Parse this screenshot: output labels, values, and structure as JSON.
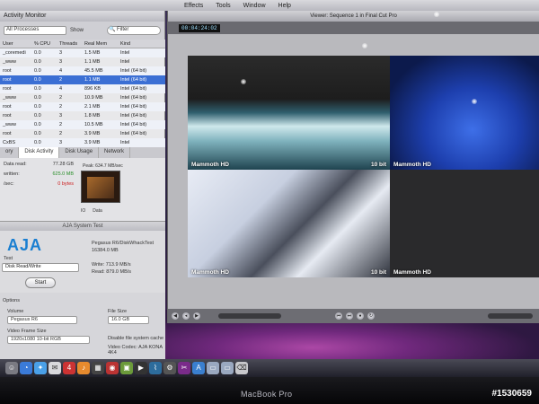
{
  "menubar": {
    "items": [
      "Effects",
      "Tools",
      "Window",
      "Help"
    ]
  },
  "activity_monitor": {
    "title": "Activity Monitor",
    "process_filter": "All Processes",
    "search_placeholder": "Filter",
    "col_show": "Show",
    "col_filter": "Filter",
    "columns": [
      "User",
      "% CPU",
      "Threads",
      "Real Mem",
      "Kind"
    ],
    "rows": [
      [
        "_coremedi",
        "0.0",
        "3",
        "1.5 MB",
        "Intel"
      ],
      [
        "_www",
        "0.0",
        "3",
        "1.1 MB",
        "Intel"
      ],
      [
        "root",
        "0.0",
        "4",
        "45.5 MB",
        "Intel (64 bit)"
      ],
      [
        "root",
        "0.0",
        "2",
        "1.1 MB",
        "Intel (64 bit)"
      ],
      [
        "root",
        "0.0",
        "4",
        "896 KB",
        "Intel (64 bit)"
      ],
      [
        "_www",
        "0.0",
        "2",
        "10.9 MB",
        "Intel (64 bit)"
      ],
      [
        "root",
        "0.0",
        "2",
        "2.1 MB",
        "Intel (64 bit)"
      ],
      [
        "root",
        "0.0",
        "3",
        "1.8 MB",
        "Intel (64 bit)"
      ],
      [
        "_www",
        "0.0",
        "2",
        "10.5 MB",
        "Intel (64 bit)"
      ],
      [
        "root",
        "0.0",
        "2",
        "3.9 MB",
        "Intel (64 bit)"
      ],
      [
        "CxBS",
        "0.0",
        "3",
        "3.9 MB",
        "Intel"
      ]
    ],
    "tabs": [
      "ory",
      "Disk Activity",
      "Disk Usage",
      "Network"
    ],
    "disk": {
      "peak": "Peak: 634.7 MB/sec",
      "data_read_label": "Data read:",
      "data_read_value": "77.28 GB",
      "written_label": "written:",
      "written_value": "625.0 MB",
      "sec_label": "/sec:",
      "sec_value": "0 bytes",
      "legend_io": "IO",
      "legend_data": "Data"
    }
  },
  "aja": {
    "title": "AJA System Test",
    "logo": "AJA",
    "volume_info": "Pegasus R6/DiskWhackTest",
    "volume_size": "16384.0 MB",
    "test_label": "Test",
    "mode": "Disk Read/Write",
    "start_label": "Start",
    "write": "Write: 713.9 MB/s",
    "read": "Read: 879.0 MB/s"
  },
  "options": {
    "title": "Options",
    "volume_label": "Volume",
    "volume_value": "Pegasus R6",
    "file_size_label": "File Size",
    "file_size_value": "16.0 GB",
    "frame_size_label": "Video Frame Size",
    "frame_size_value": "1920x1080 10-bit RGB",
    "cache_label": "Disable file system cache",
    "codec_label": "Video Codec: AJA KONA 4K4"
  },
  "viewer": {
    "title": "Viewer: Sequence 1 in Final Cut Pro",
    "timecode": "00:04:24:02",
    "clips": [
      {
        "label": "Mammoth HD",
        "right": "10 bit"
      },
      {
        "label": "Mammoth HD",
        "right": ""
      },
      {
        "label": "Mammoth HD",
        "right": "10 bit"
      },
      {
        "label": "Mammoth HD",
        "right": ""
      }
    ]
  },
  "bezel": {
    "brand": "MacBook Pro"
  },
  "watermark": "#1530659"
}
